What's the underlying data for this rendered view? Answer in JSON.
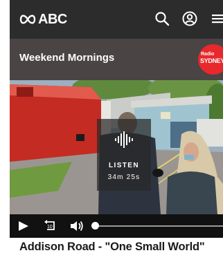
{
  "header": {
    "logo_text": "ABC",
    "icons": [
      "abc-lissajous-icon",
      "search-icon",
      "account-icon",
      "menu-icon"
    ]
  },
  "program": {
    "title": "Weekend Mornings",
    "station_badge_line1": "Radio",
    "station_badge_line2": "SYDNEY"
  },
  "player": {
    "listen_label": "LISTEN",
    "duration": "34m 25s",
    "progress_fraction": 0
  },
  "episode": {
    "title": "Addison Road - \"One Small World\""
  },
  "colors": {
    "header_bg": "#2c2c2c",
    "program_bg": "#4a4445",
    "badge_red": "#e8282b",
    "controls_bg": "#111111"
  }
}
